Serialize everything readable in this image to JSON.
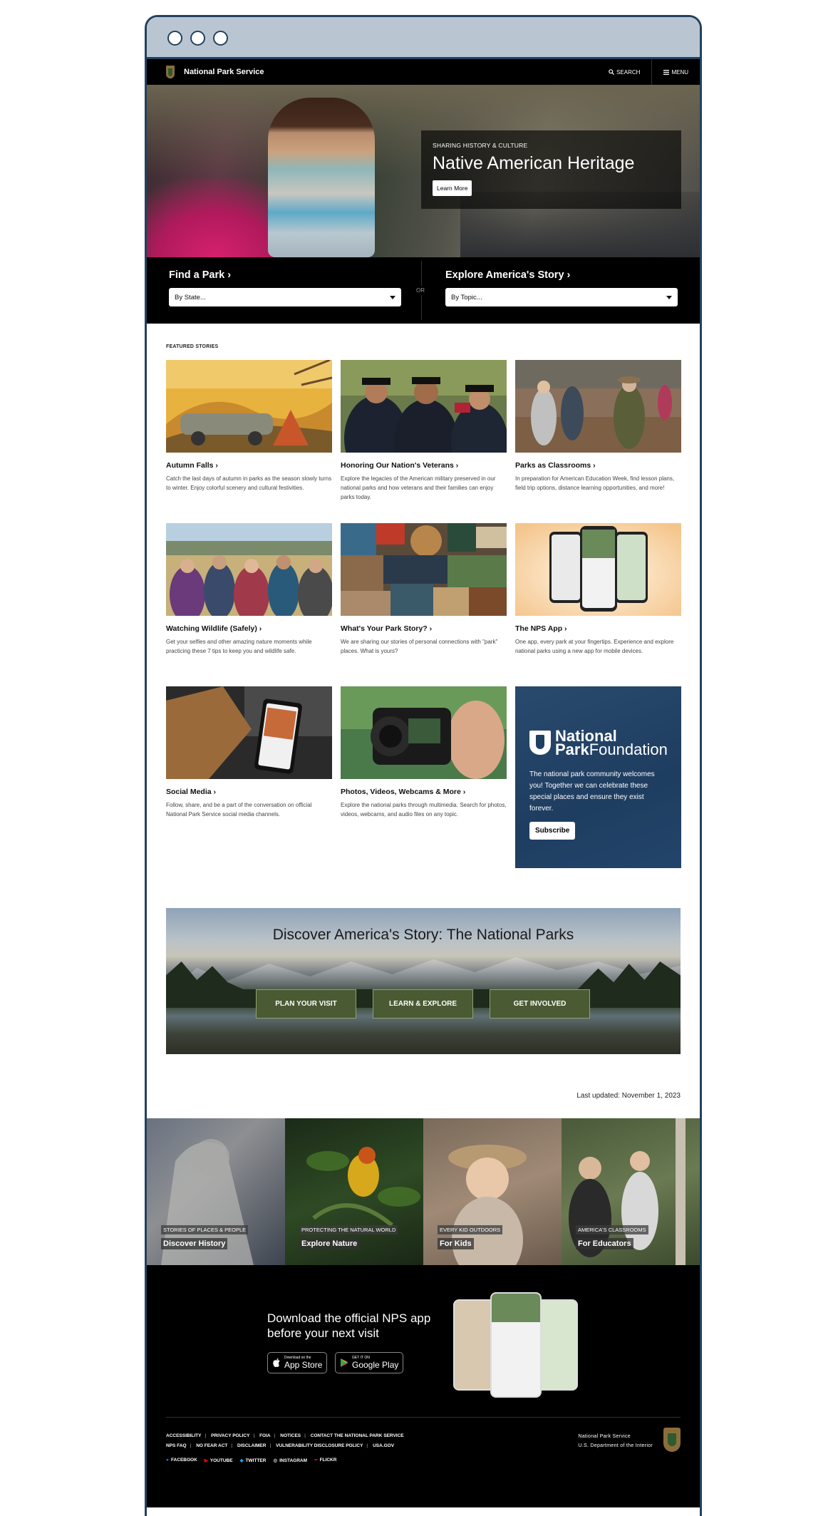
{
  "header": {
    "brand": "National Park Service",
    "search_label": "SEARCH",
    "menu_label": "MENU"
  },
  "hero": {
    "kicker": "SHARING HISTORY & CULTURE",
    "title": "Native American Heritage",
    "button": "Learn More"
  },
  "finder": {
    "find_title": "Find a Park",
    "find_select": "By State...",
    "or": "OR",
    "explore_title": "Explore America's Story",
    "explore_select": "By Topic..."
  },
  "featured": {
    "label": "FEATURED STORIES",
    "cards": [
      {
        "title": "Autumn Falls",
        "desc": "Catch the last days of autumn in parks as the season slowly turns to winter. Enjoy colorful scenery and cultural festivities."
      },
      {
        "title": "Honoring Our Nation's Veterans",
        "desc": "Explore the legacies of the American military preserved in our national parks and how veterans and their families can enjoy parks today."
      },
      {
        "title": "Parks as Classrooms",
        "desc": "In preparation for American Education Week, find lesson plans, field trip options, distance learning opportunities, and more!"
      },
      {
        "title": "Watching Wildlife (Safely)",
        "desc": "Get your selfies and other amazing nature moments while practicing these 7 tips to keep you and wildlife safe."
      },
      {
        "title": "What's Your Park Story?",
        "desc": "We are sharing our stories of personal connections with \"park\" places. What is yours?"
      },
      {
        "title": "The NPS App",
        "desc": "One app, every park at your fingertips. Experience and explore national parks using a new app for mobile devices."
      },
      {
        "title": "Social Media",
        "desc": "Follow, share, and be a part of the conversation on official National Park Service social media channels."
      },
      {
        "title": "Photos, Videos, Webcams & More",
        "desc": "Explore the national parks through multimedia. Search for photos, videos, webcams, and audio files on any topic."
      }
    ],
    "npf": {
      "line1": "National",
      "line2a": "Park",
      "line2b": "Foundation",
      "text": "The national park community welcomes you! Together we can celebrate these special places and ensure they exist forever.",
      "button": "Subscribe"
    }
  },
  "banner": {
    "title": "Discover America's Story: The National Parks",
    "buttons": [
      "PLAN YOUR VISIT",
      "LEARN & EXPLORE",
      "GET INVOLVED"
    ]
  },
  "last_updated": "Last updated: November 1, 2023",
  "tiles": [
    {
      "kicker": "STORIES OF PLACES & PEOPLE",
      "title": "Discover History"
    },
    {
      "kicker": "PROTECTING THE NATURAL WORLD",
      "title": "Explore Nature"
    },
    {
      "kicker": "EVERY KID OUTDOORS",
      "title": "For Kids"
    },
    {
      "kicker": "AMERICA'S CLASSROOMS",
      "title": "For Educators"
    }
  ],
  "footer": {
    "app_line1": "Download the official NPS app",
    "app_line2": "before your next visit",
    "appstore_small": "Download on the",
    "appstore_big": "App Store",
    "gplay_small": "GET IT ON",
    "gplay_big": "Google Play",
    "links_row1": [
      "ACCESSIBILITY",
      "PRIVACY POLICY",
      "FOIA",
      "NOTICES",
      "CONTACT THE NATIONAL PARK SERVICE"
    ],
    "links_row2": [
      "NPS FAQ",
      "NO FEAR ACT",
      "DISCLAIMER",
      "VULNERABILITY DISCLOSURE POLICY",
      "USA.GOV"
    ],
    "social": [
      "FACEBOOK",
      "YOUTUBE",
      "TWITTER",
      "INSTAGRAM",
      "FLICKR"
    ],
    "dept_line1": "National Park Service",
    "dept_line2": "U.S. Department of the Interior"
  }
}
